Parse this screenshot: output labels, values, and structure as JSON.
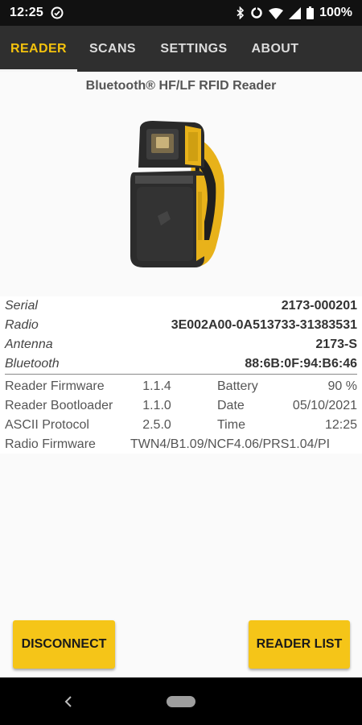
{
  "status_bar": {
    "time": "12:25",
    "battery": "100%",
    "icons": [
      "do-not-disturb-icon",
      "bluetooth-icon",
      "data-saver-icon",
      "wifi-icon",
      "signal-icon",
      "battery-icon"
    ]
  },
  "tabs": [
    {
      "label": "READER",
      "active": true
    },
    {
      "label": "SCANS",
      "active": false
    },
    {
      "label": "SETTINGS",
      "active": false
    },
    {
      "label": "ABOUT",
      "active": false
    }
  ],
  "reader": {
    "title": "Bluetooth® HF/LF RFID Reader",
    "details": [
      {
        "label": "Serial",
        "value": "2173-000201"
      },
      {
        "label": "Radio",
        "value": "3E002A00-0A513733-31383531"
      },
      {
        "label": "Antenna",
        "value": "2173-S"
      },
      {
        "label": "Bluetooth",
        "value": "88:6B:0F:94:B6:46"
      }
    ],
    "grid": [
      {
        "label": "Reader Firmware",
        "value": "1.1.4",
        "label2": "Battery",
        "value2": "90 %"
      },
      {
        "label": "Reader Bootloader",
        "value": "1.1.0",
        "label2": "Date",
        "value2": "05/10/2021"
      },
      {
        "label": "ASCII Protocol",
        "value": "2.5.0",
        "label2": "Time",
        "value2": "12:25"
      }
    ],
    "radio_firmware_label": "Radio Firmware",
    "radio_firmware_value": "TWN4/B1.09/NCF4.06/PRS1.04/PI"
  },
  "buttons": {
    "disconnect": "DISCONNECT",
    "reader_list": "READER LIST"
  },
  "colors": {
    "accent": "#f4c20d",
    "button": "#f5c518",
    "tab_bar": "#2f2f2f"
  }
}
